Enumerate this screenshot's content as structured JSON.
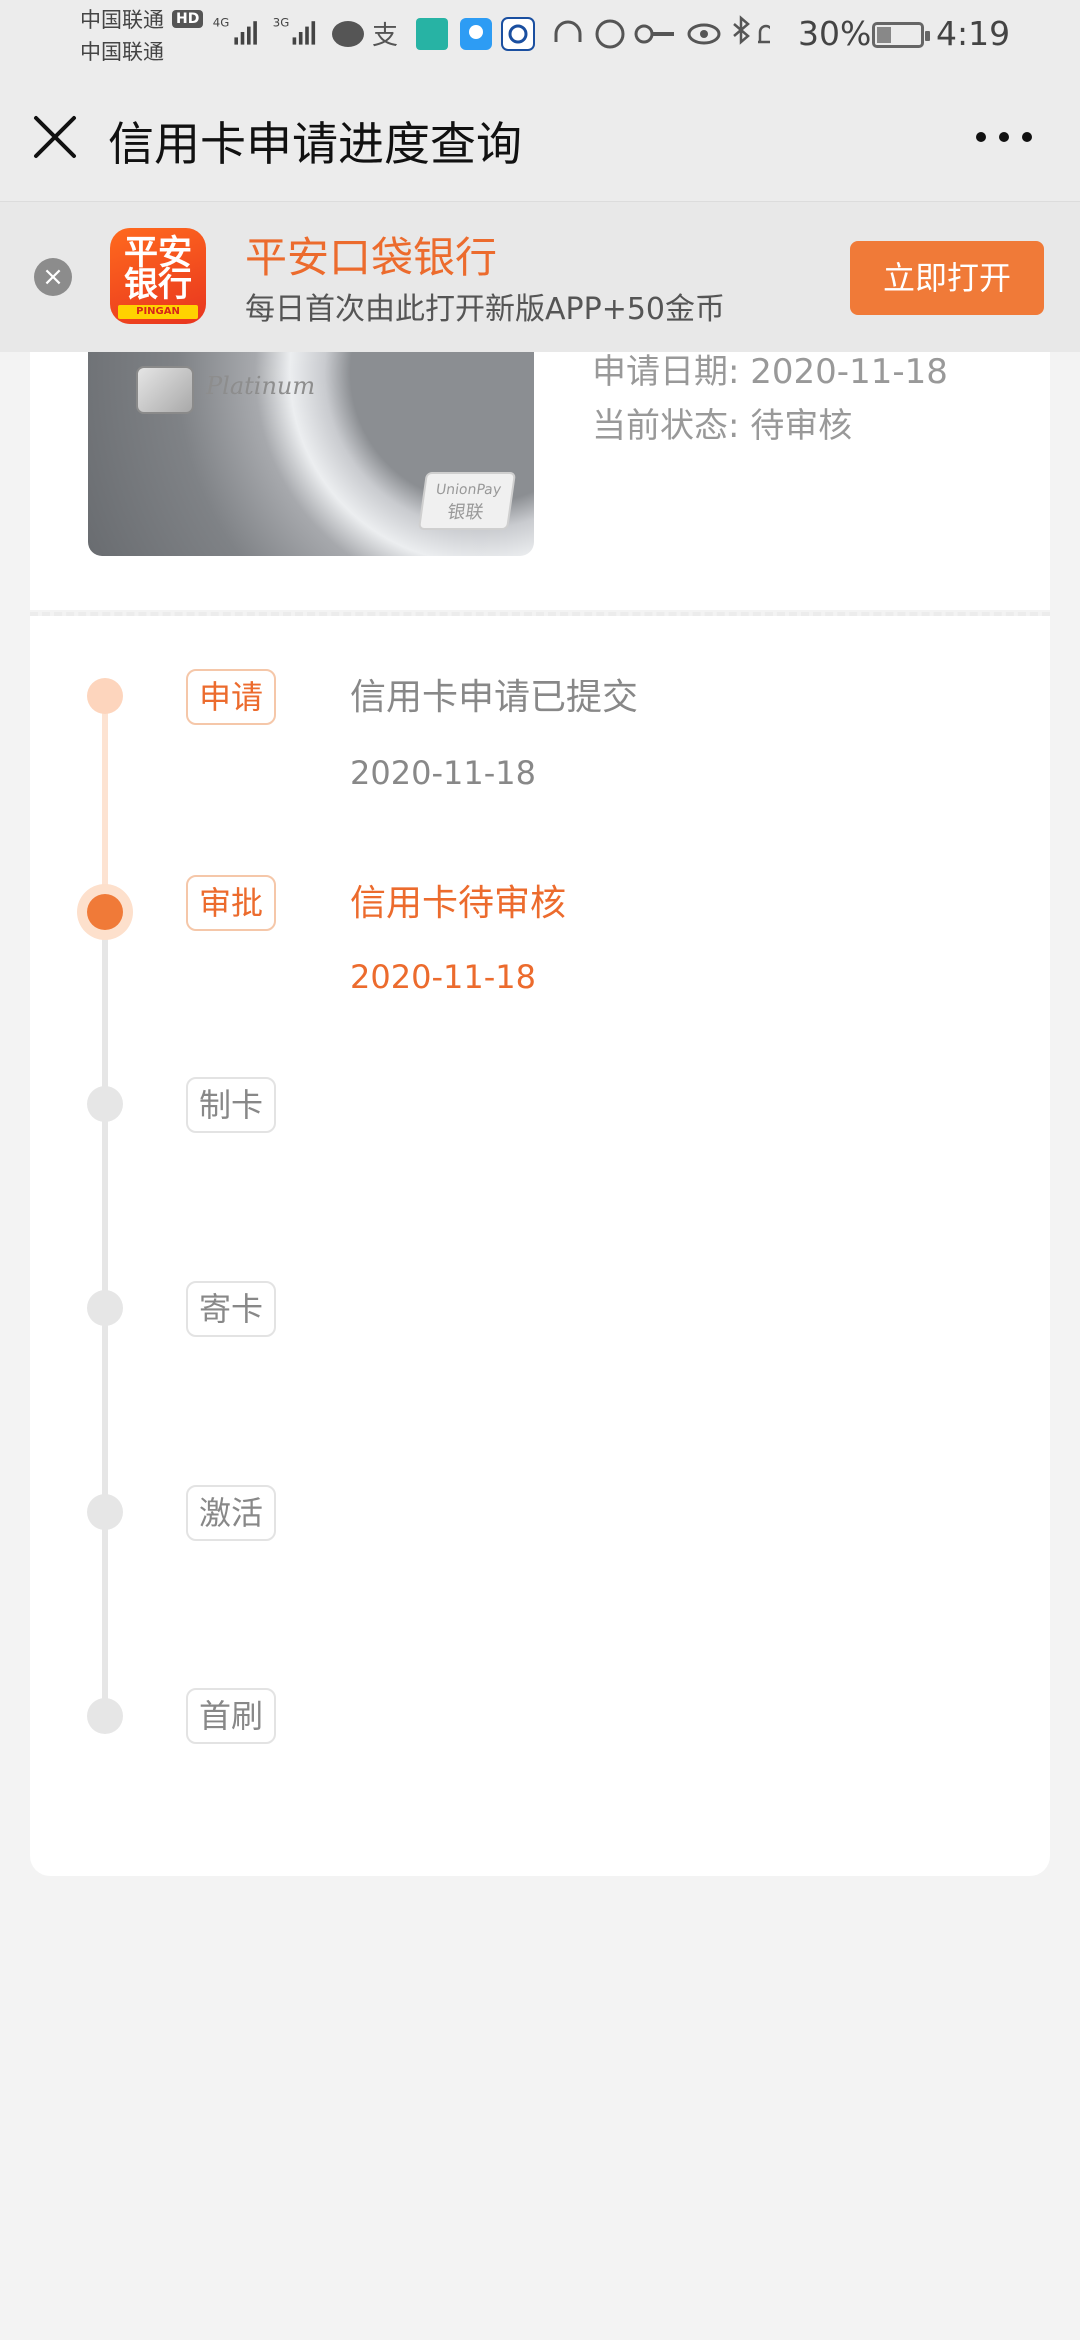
{
  "status_bar": {
    "carrier1": "中国联通",
    "carrier2": "中国联通",
    "hd": "HD",
    "net1": "4G",
    "net2": "3G",
    "battery": "30%",
    "time": "4:19"
  },
  "nav": {
    "title": "信用卡申请进度查询"
  },
  "banner": {
    "logo_line1": "平安",
    "logo_line2": "银行",
    "logo_brand": "PINGAN",
    "title": "平安口袋银行",
    "subtitle": "每日首次由此打开新版APP+50金币",
    "button": "立即打开"
  },
  "card": {
    "card_text": "Platinum",
    "unionpay_label": "UnionPay",
    "unionpay_cn": "银联",
    "date_label": "申请日期:",
    "date_value": "2020-11-18",
    "status_label": "当前状态:",
    "status_value": "待审核"
  },
  "steps": [
    {
      "tag": "申请",
      "title": "信用卡申请已提交",
      "date": "2020-11-18"
    },
    {
      "tag": "审批",
      "title": "信用卡待审核",
      "date": "2020-11-18"
    },
    {
      "tag": "制卡"
    },
    {
      "tag": "寄卡"
    },
    {
      "tag": "激活"
    },
    {
      "tag": "首刷"
    }
  ],
  "colors": {
    "accent": "#ec6b2d",
    "button": "#f07a38",
    "light_accent": "#fde3d2",
    "inactive": "#e6e6e6"
  }
}
